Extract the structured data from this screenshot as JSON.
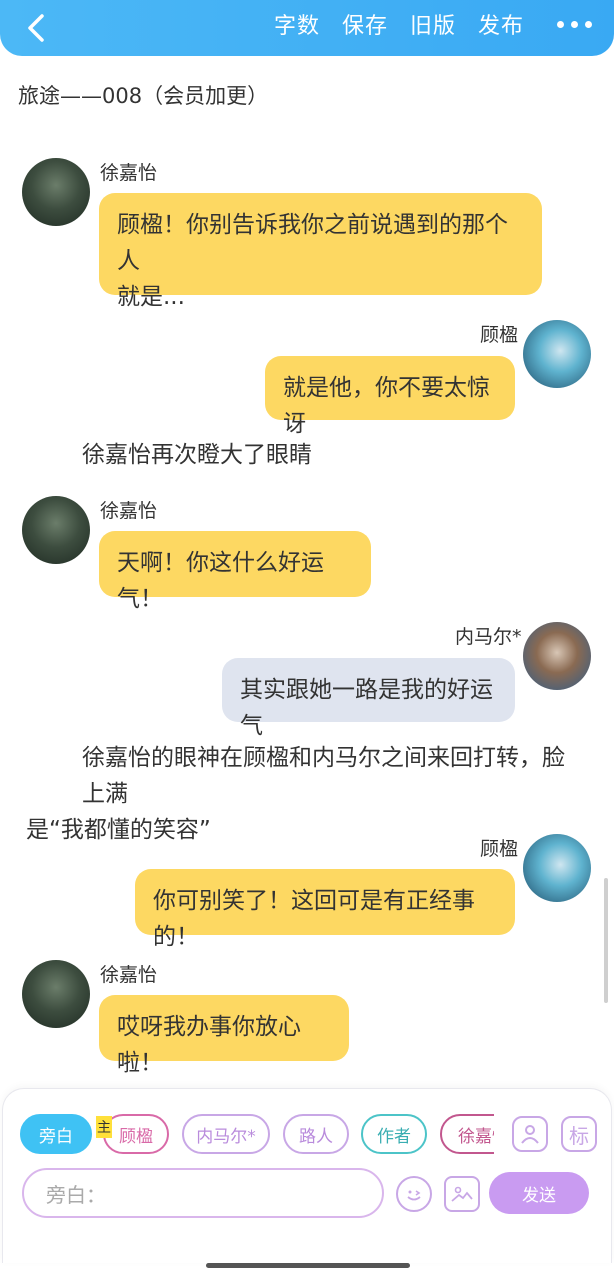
{
  "topbar": {
    "actions": [
      "字数",
      "保存",
      "旧版",
      "发布"
    ]
  },
  "story_title": "旅途——008（会员加更）",
  "messages": [
    {
      "type": "left",
      "name": "徐嘉怡",
      "text_lines": [
        "顾楹！你别告诉我你之前说遇到的那个人",
        "就是..."
      ]
    },
    {
      "type": "right",
      "name": "顾楹",
      "text": "就是他，你不要太惊讶"
    },
    {
      "type": "narration",
      "text": "徐嘉怡再次瞪大了眼睛"
    },
    {
      "type": "left",
      "name": "徐嘉怡",
      "text": "天啊！你这什么好运气！"
    },
    {
      "type": "right",
      "name": "内马尔*",
      "text": "其实跟她一路是我的好运气"
    },
    {
      "type": "narration",
      "text_lines": [
        "徐嘉怡的眼神在顾楹和内马尔之间来回打转，脸上满",
        "是“我都懂的笑容”"
      ]
    },
    {
      "type": "right",
      "name": "顾楹",
      "text": "你可别笑了！这回可是有正经事的！"
    },
    {
      "type": "left",
      "name": "徐嘉怡",
      "text": "哎呀我办事你放心啦！"
    }
  ],
  "composer": {
    "chips": [
      "旁白",
      "顾楹",
      "内马尔*",
      "路人",
      "作者",
      "徐嘉怡"
    ],
    "main_tag": "主",
    "tag_button": "标",
    "input_placeholder": "旁白：",
    "send_label": "发送"
  },
  "colors": {
    "topbar": "#3fb0f5",
    "bubble_yellow": "#fdd862",
    "bubble_gray": "#dfe4ef",
    "chip_active": "#3fc2f4",
    "send": "#c99bf1"
  }
}
